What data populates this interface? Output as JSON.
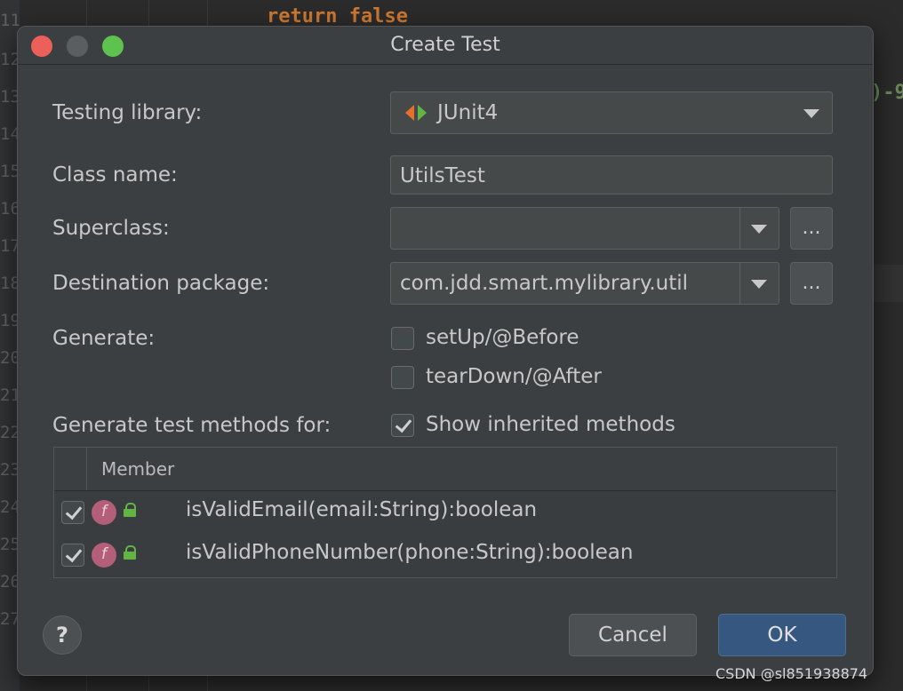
{
  "background": {
    "line_numbers": [
      "11",
      "12",
      "13",
      "14",
      "15",
      "16",
      "17",
      "18",
      "19",
      "20",
      "21",
      "22",
      "23",
      "24",
      "25",
      "26",
      "27"
    ],
    "code_top": "return false",
    "code_right": ")-9"
  },
  "dialog": {
    "title": "Create Test",
    "testing_library": {
      "label": "Testing library:",
      "value": "JUnit4",
      "icon": "junit-icon"
    },
    "class_name": {
      "label": "Class name:",
      "value": "UtilsTest"
    },
    "superclass": {
      "label": "Superclass:",
      "value": "",
      "browse_label": "..."
    },
    "destination_package": {
      "label": "Destination package:",
      "value": "com.jdd.smart.mylibrary.util",
      "browse_label": "..."
    },
    "generate": {
      "label": "Generate:",
      "options": [
        {
          "label": "setUp/@Before",
          "checked": false
        },
        {
          "label": "tearDown/@After",
          "checked": false
        }
      ]
    },
    "generate_methods": {
      "label": "Generate test methods for:",
      "show_inherited": {
        "label": "Show inherited methods",
        "checked": true
      }
    },
    "table": {
      "header": "Member",
      "rows": [
        {
          "checked": true,
          "icon": "f",
          "member": "isValidEmail(email:String):boolean"
        },
        {
          "checked": true,
          "icon": "f",
          "member": "isValidPhoneNumber(phone:String):boolean"
        }
      ]
    },
    "help_label": "?",
    "cancel_label": "Cancel",
    "ok_label": "OK"
  },
  "watermark": "CSDN @sl851938874",
  "colors": {
    "accent_ok": "#365880",
    "close": "#ec5f5a",
    "zoom": "#5ec24f",
    "method_icon": "#b35f7a"
  }
}
